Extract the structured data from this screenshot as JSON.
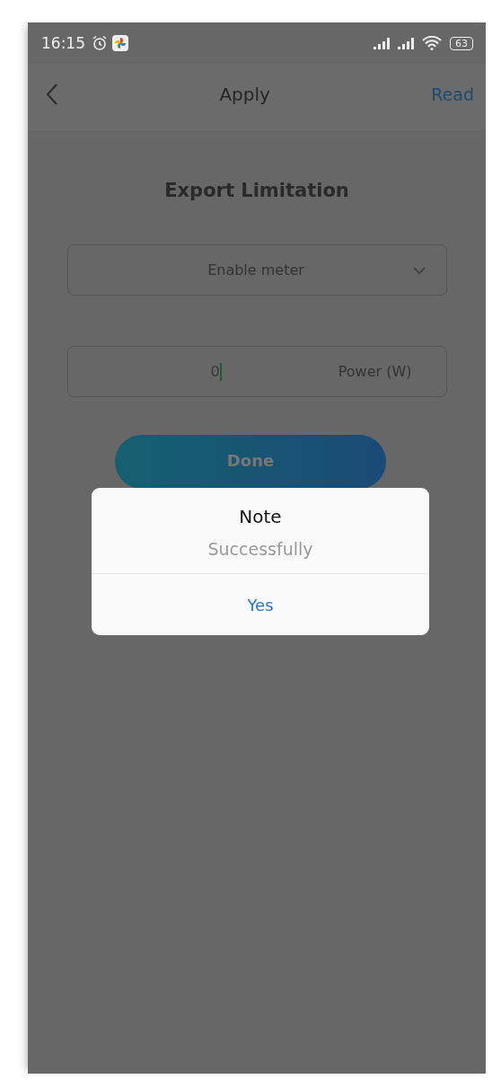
{
  "status_bar": {
    "time": "16:15",
    "battery": "63"
  },
  "nav": {
    "title": "Apply",
    "action": "Read"
  },
  "page": {
    "heading": "Export Limitation",
    "dropdown": {
      "value": "Enable meter"
    },
    "power_field": {
      "value": "0",
      "unit": "Power (W)",
      "focused": true
    },
    "button": "Done"
  },
  "dialog": {
    "title": "Note",
    "message": "Successfully",
    "button": "Yes"
  }
}
